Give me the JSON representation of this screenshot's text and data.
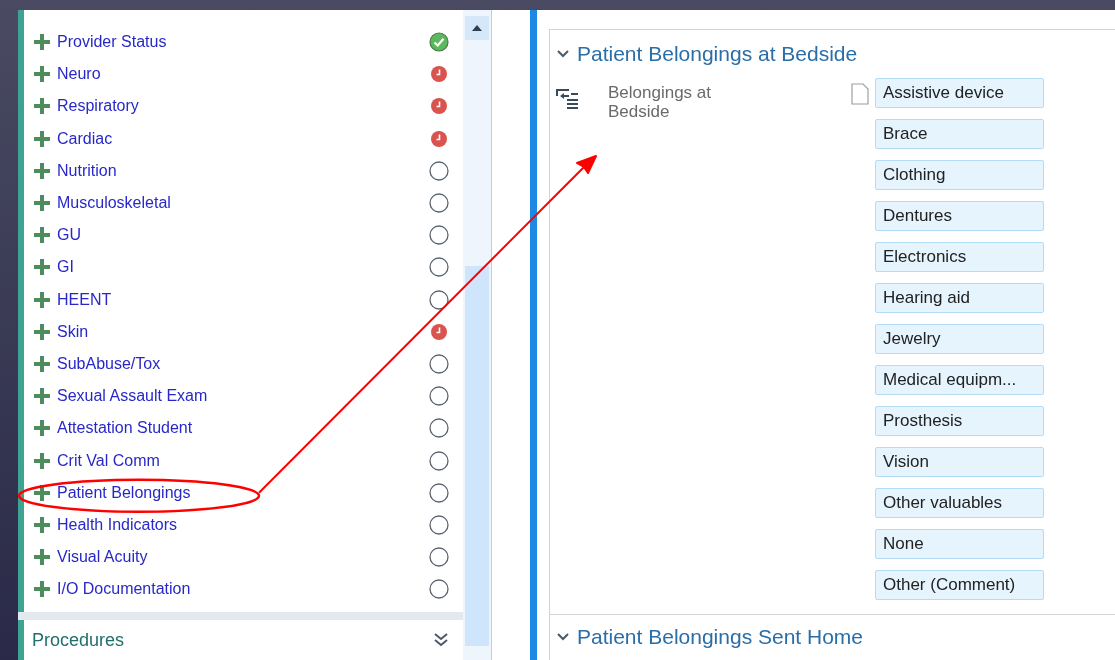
{
  "sidebar": {
    "items": [
      {
        "label": "Provider Status",
        "completed": true,
        "overdue": false
      },
      {
        "label": "Neuro",
        "completed": false,
        "overdue": true
      },
      {
        "label": "Respiratory",
        "completed": false,
        "overdue": true
      },
      {
        "label": "Cardiac",
        "completed": false,
        "overdue": true
      },
      {
        "label": "Nutrition",
        "completed": false,
        "overdue": false
      },
      {
        "label": "Musculoskeletal",
        "completed": false,
        "overdue": false
      },
      {
        "label": "GU",
        "completed": false,
        "overdue": false
      },
      {
        "label": "GI",
        "completed": false,
        "overdue": false
      },
      {
        "label": "HEENT",
        "completed": false,
        "overdue": false
      },
      {
        "label": "Skin",
        "completed": false,
        "overdue": true
      },
      {
        "label": "SubAbuse/Tox",
        "completed": false,
        "overdue": false
      },
      {
        "label": "Sexual Assault Exam",
        "completed": false,
        "overdue": false
      },
      {
        "label": "Attestation Student",
        "completed": false,
        "overdue": false
      },
      {
        "label": "Crit Val Comm",
        "completed": false,
        "overdue": false
      },
      {
        "label": "Patient Belongings",
        "completed": false,
        "overdue": false,
        "circled": true
      },
      {
        "label": "Health Indicators",
        "completed": false,
        "overdue": false
      },
      {
        "label": "Visual Acuity",
        "completed": false,
        "overdue": false
      },
      {
        "label": "I/O Documentation",
        "completed": false,
        "overdue": false
      }
    ],
    "footer": {
      "label": "Procedures"
    }
  },
  "sections": [
    {
      "title": "Patient Belongings at Bedside",
      "field": {
        "label": "Belongings at Bedside",
        "options": [
          "Assistive device",
          "Brace",
          "Clothing",
          "Dentures",
          "Electronics",
          "Hearing aid",
          "Jewelry",
          "Medical equipm...",
          "Prosthesis",
          "Vision",
          "Other valuables",
          "None",
          "Other (Comment)"
        ]
      }
    },
    {
      "title": "Patient Belongings Sent Home"
    }
  ]
}
